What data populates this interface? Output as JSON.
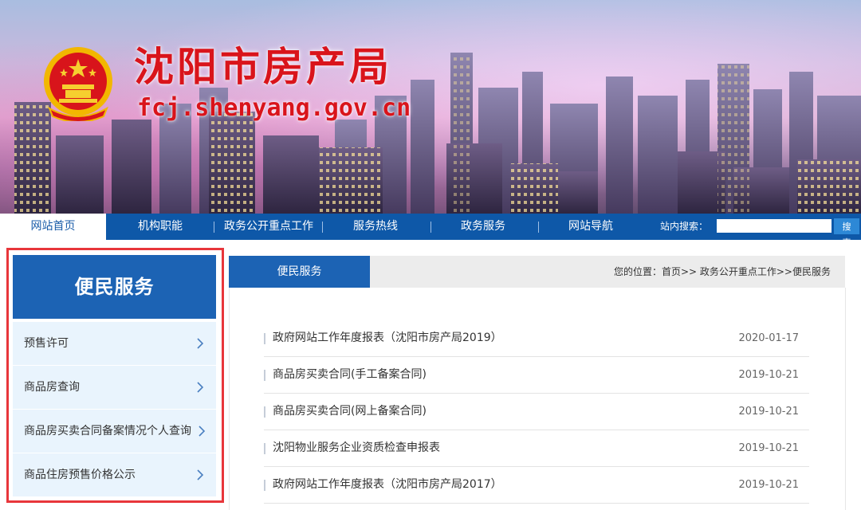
{
  "header": {
    "site_title": "沈阳市房产局",
    "site_domain": "fcj.shenyang.gov.cn",
    "emblem_icon": "national-emblem-icon"
  },
  "nav": {
    "items": [
      {
        "label": "网站首页",
        "active": true
      },
      {
        "label": "机构职能"
      },
      {
        "label": "政务公开重点工作"
      },
      {
        "label": "服务热线"
      },
      {
        "label": "政务服务"
      },
      {
        "label": "网站导航"
      }
    ],
    "search_label": "站内搜索：",
    "search_value": "",
    "search_button": "搜索"
  },
  "sidebar": {
    "title": "便民服务",
    "items": [
      {
        "label": "预售许可"
      },
      {
        "label": "商品房查询"
      },
      {
        "label": "商品房买卖合同备案情况个人查询"
      },
      {
        "label": "商品住房预售价格公示"
      }
    ]
  },
  "main": {
    "tab_label": "便民服务",
    "breadcrumb": "您的位置：首页>> 政务公开重点工作>>便民服务",
    "news": [
      {
        "title": "政府网站工作年度报表（沈阳市房产局2019）",
        "date": "2020-01-17"
      },
      {
        "title": "商品房买卖合同(手工备案合同)",
        "date": "2019-10-21"
      },
      {
        "title": "商品房买卖合同(网上备案合同)",
        "date": "2019-10-21"
      },
      {
        "title": "沈阳物业服务企业资质检查申报表",
        "date": "2019-10-21"
      },
      {
        "title": "政府网站工作年度报表（沈阳市房产局2017）",
        "date": "2019-10-21"
      }
    ]
  },
  "colors": {
    "brand_blue": "#1c63b4",
    "nav_blue": "#0e58a8",
    "title_red": "#d9141b",
    "highlight_red": "#e8363b",
    "sidebar_item_bg": "#e9f4fd"
  }
}
